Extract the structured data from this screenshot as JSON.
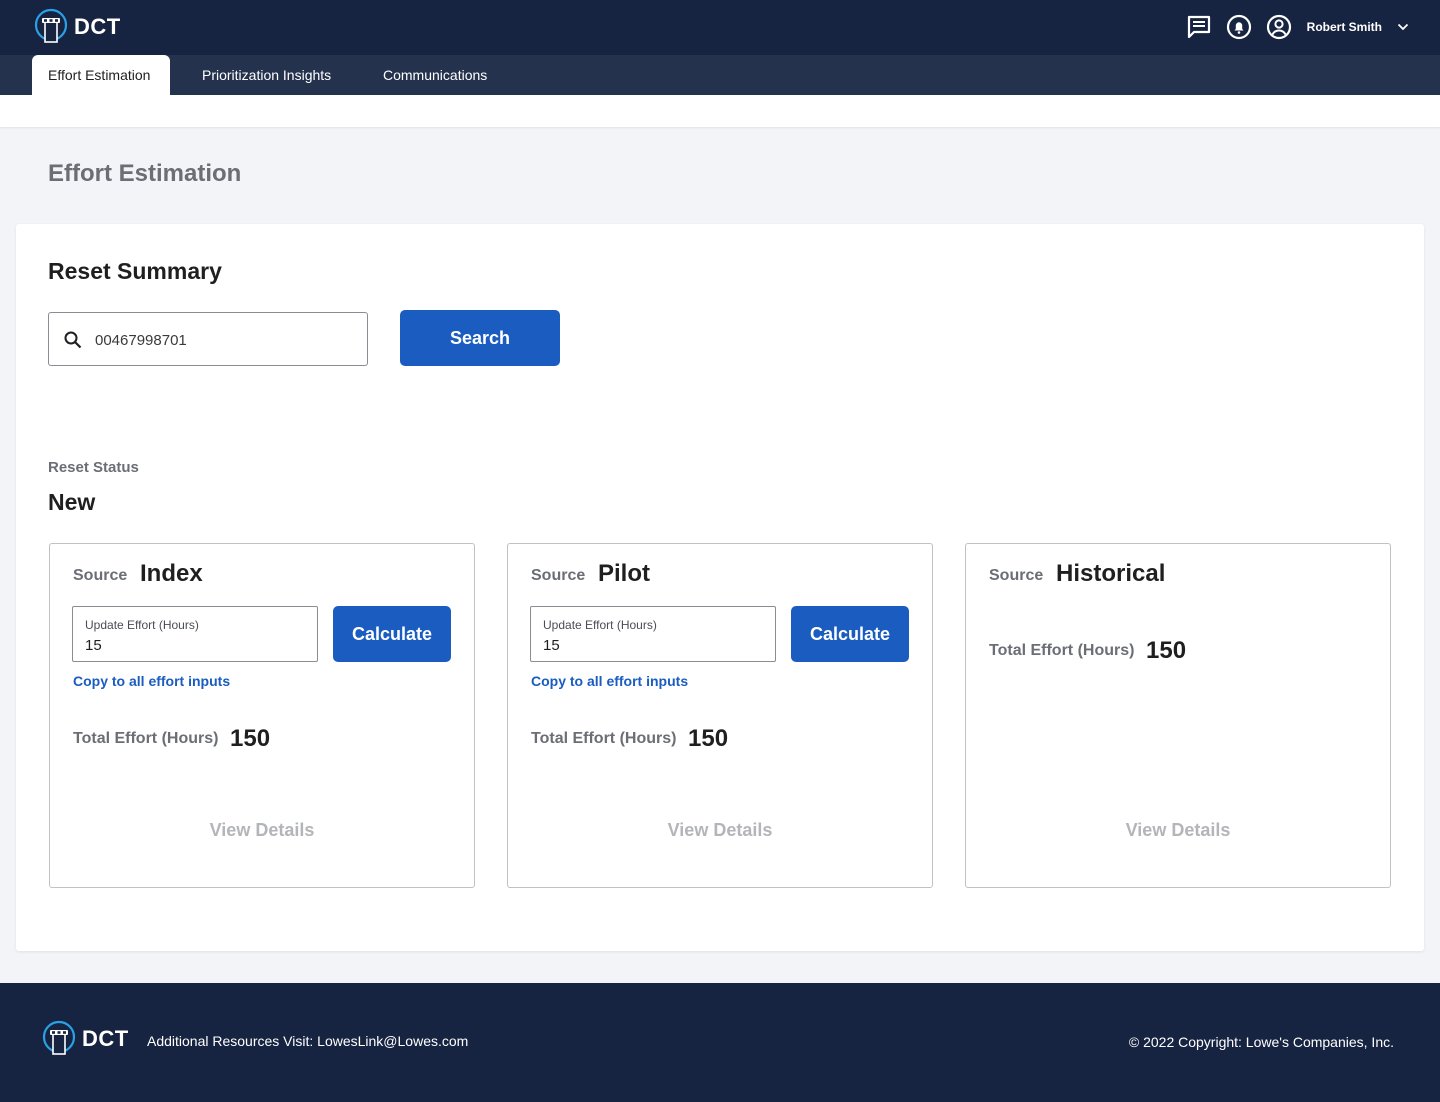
{
  "app": {
    "brand": "DCT",
    "user_name": "Robert Smith",
    "icons": [
      "chat-icon",
      "bell-icon",
      "account-icon",
      "chevron-down-icon"
    ]
  },
  "tabs": [
    {
      "label": "Effort Estimation",
      "active": true
    },
    {
      "label": "Prioritization Insights",
      "active": false
    },
    {
      "label": "Communications",
      "active": false
    }
  ],
  "page": {
    "title": "Effort Estimation"
  },
  "reset_summary": {
    "title": "Reset Summary",
    "search_value": "00467998701",
    "search_button": "Search",
    "status_label": "Reset Status",
    "status_value": "New"
  },
  "cards": [
    {
      "source_label": "Source",
      "source_value": "Index",
      "effort_label": "Update Effort (Hours)",
      "effort_value": "15",
      "calculate_label": "Calculate",
      "copy_link": "Copy to all effort inputs",
      "total_label": "Total Effort (Hours)",
      "total_value": "150",
      "details_label": "View Details"
    },
    {
      "source_label": "Source",
      "source_value": "Pilot",
      "effort_label": "Update Effort (Hours)",
      "effort_value": "15",
      "calculate_label": "Calculate",
      "copy_link": "Copy to all effort inputs",
      "total_label": "Total Effort (Hours)",
      "total_value": "150",
      "details_label": "View Details"
    },
    {
      "source_label": "Source",
      "source_value": "Historical",
      "total_label": "Total Effort (Hours)",
      "total_value": "150",
      "details_label": "View Details"
    }
  ],
  "footer": {
    "brand": "DCT",
    "resources": "Additional Resources Visit: LowesLink@Lowes.com",
    "copyright": "© 2022 Copyright: Lowe's Companies, Inc."
  },
  "colors": {
    "navy": "#172441",
    "tabbar": "#25324e",
    "primary": "#1a5cc0",
    "muted_text": "#6b6e75"
  }
}
